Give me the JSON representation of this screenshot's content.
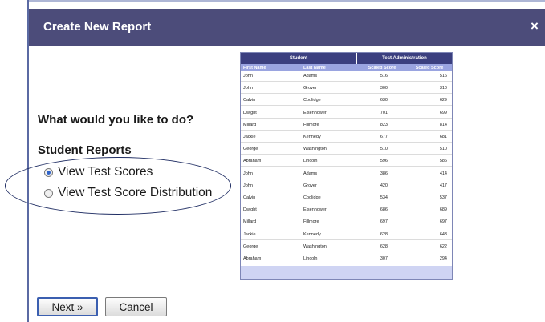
{
  "dialog": {
    "title": "Create New Report",
    "close_label": "×",
    "question": "What would you like to do?",
    "section_label": "Student Reports",
    "options": [
      {
        "label": "View Test Scores",
        "selected": true
      },
      {
        "label": "View Test Score Distribution",
        "selected": false
      }
    ],
    "buttons": {
      "next": "Next »",
      "cancel": "Cancel"
    }
  },
  "preview_table": {
    "group_headers": [
      "Student",
      "Test Administration"
    ],
    "columns": [
      "First Name",
      "Last Name",
      "Scaled Score",
      "Scaled Score"
    ],
    "rows": [
      [
        "John",
        "Adams",
        "516",
        "516"
      ],
      [
        "John",
        "Grover",
        "300",
        "310"
      ],
      [
        "Calvin",
        "Coolidge",
        "630",
        "629"
      ],
      [
        "Dwight",
        "Eisenhower",
        "701",
        "699"
      ],
      [
        "Millard",
        "Fillmore",
        "823",
        "814"
      ],
      [
        "Jackie",
        "Kennedy",
        "677",
        "681"
      ],
      [
        "George",
        "Washington",
        "510",
        "510"
      ],
      [
        "Abraham",
        "Lincoln",
        "596",
        "586"
      ],
      [
        "John",
        "Adams",
        "386",
        "414"
      ],
      [
        "John",
        "Grover",
        "420",
        "417"
      ],
      [
        "Calvin",
        "Coolidge",
        "534",
        "537"
      ],
      [
        "Dwight",
        "Eisenhower",
        "686",
        "689"
      ],
      [
        "Millard",
        "Fillmore",
        "697",
        "697"
      ],
      [
        "Jackie",
        "Kennedy",
        "628",
        "643"
      ],
      [
        "George",
        "Washington",
        "628",
        "622"
      ],
      [
        "Abraham",
        "Lincoln",
        "307",
        "294"
      ]
    ]
  },
  "colors": {
    "titlebar": "#4c4c7a",
    "accent_radio": "#2f63c9",
    "table_header": "#3b3f7f",
    "table_subheader": "#9aa4e0"
  }
}
